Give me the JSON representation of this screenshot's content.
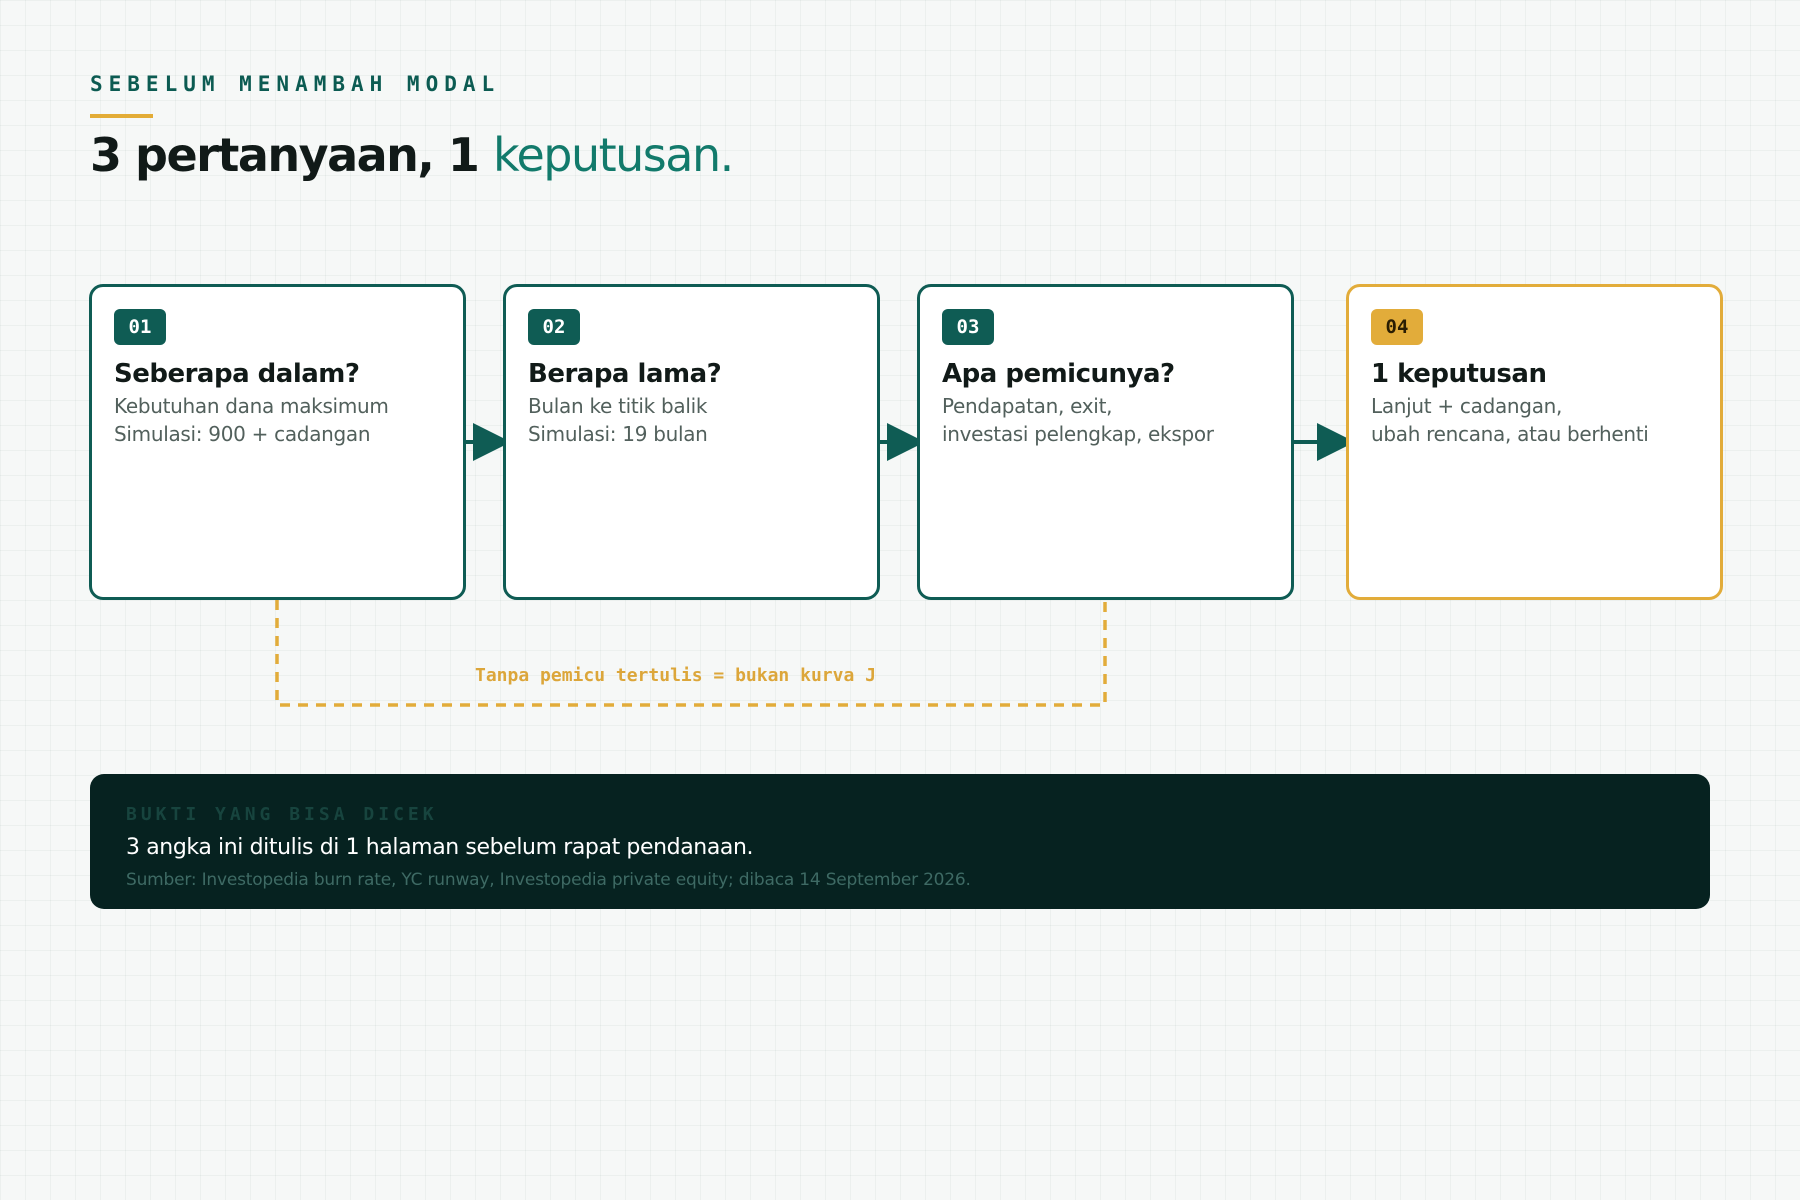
{
  "header": {
    "eyebrow": "SEBELUM MENAMBAH MODAL",
    "title_main": "3 pertanyaan, 1",
    "title_accent": "keputusan."
  },
  "steps": [
    {
      "number": "01",
      "title": "Seberapa dalam?",
      "lines": [
        "Kebutuhan dana maksimum",
        "Simulasi: 900 + cadangan"
      ]
    },
    {
      "number": "02",
      "title": "Berapa lama?",
      "lines": [
        "Bulan ke titik balik",
        "Simulasi: 19 bulan"
      ]
    },
    {
      "number": "03",
      "title": "Apa pemicunya?",
      "lines": [
        "Pendapatan, exit,",
        "investasi pelengkap, ekspor"
      ]
    },
    {
      "number": "04",
      "title": "1 keputusan",
      "lines": [
        "Lanjut + cadangan,",
        "ubah rencana, atau berhenti"
      ]
    }
  ],
  "loop": {
    "label": "Tanpa pemicu tertulis = bukan kurva J"
  },
  "evidence": {
    "label": "BUKTI YANG BISA DICEK",
    "main": "3 angka ini ditulis di 1 halaman sebelum rapat pendanaan.",
    "source": "Sumber: Investopedia burn rate, YC runway, Investopedia private equity; dibaca 14 September 2026."
  },
  "colors": {
    "teal": "#0f5c54",
    "gold": "#e2ac3a",
    "dark_panel": "#062220",
    "background": "#f6f8f7"
  }
}
